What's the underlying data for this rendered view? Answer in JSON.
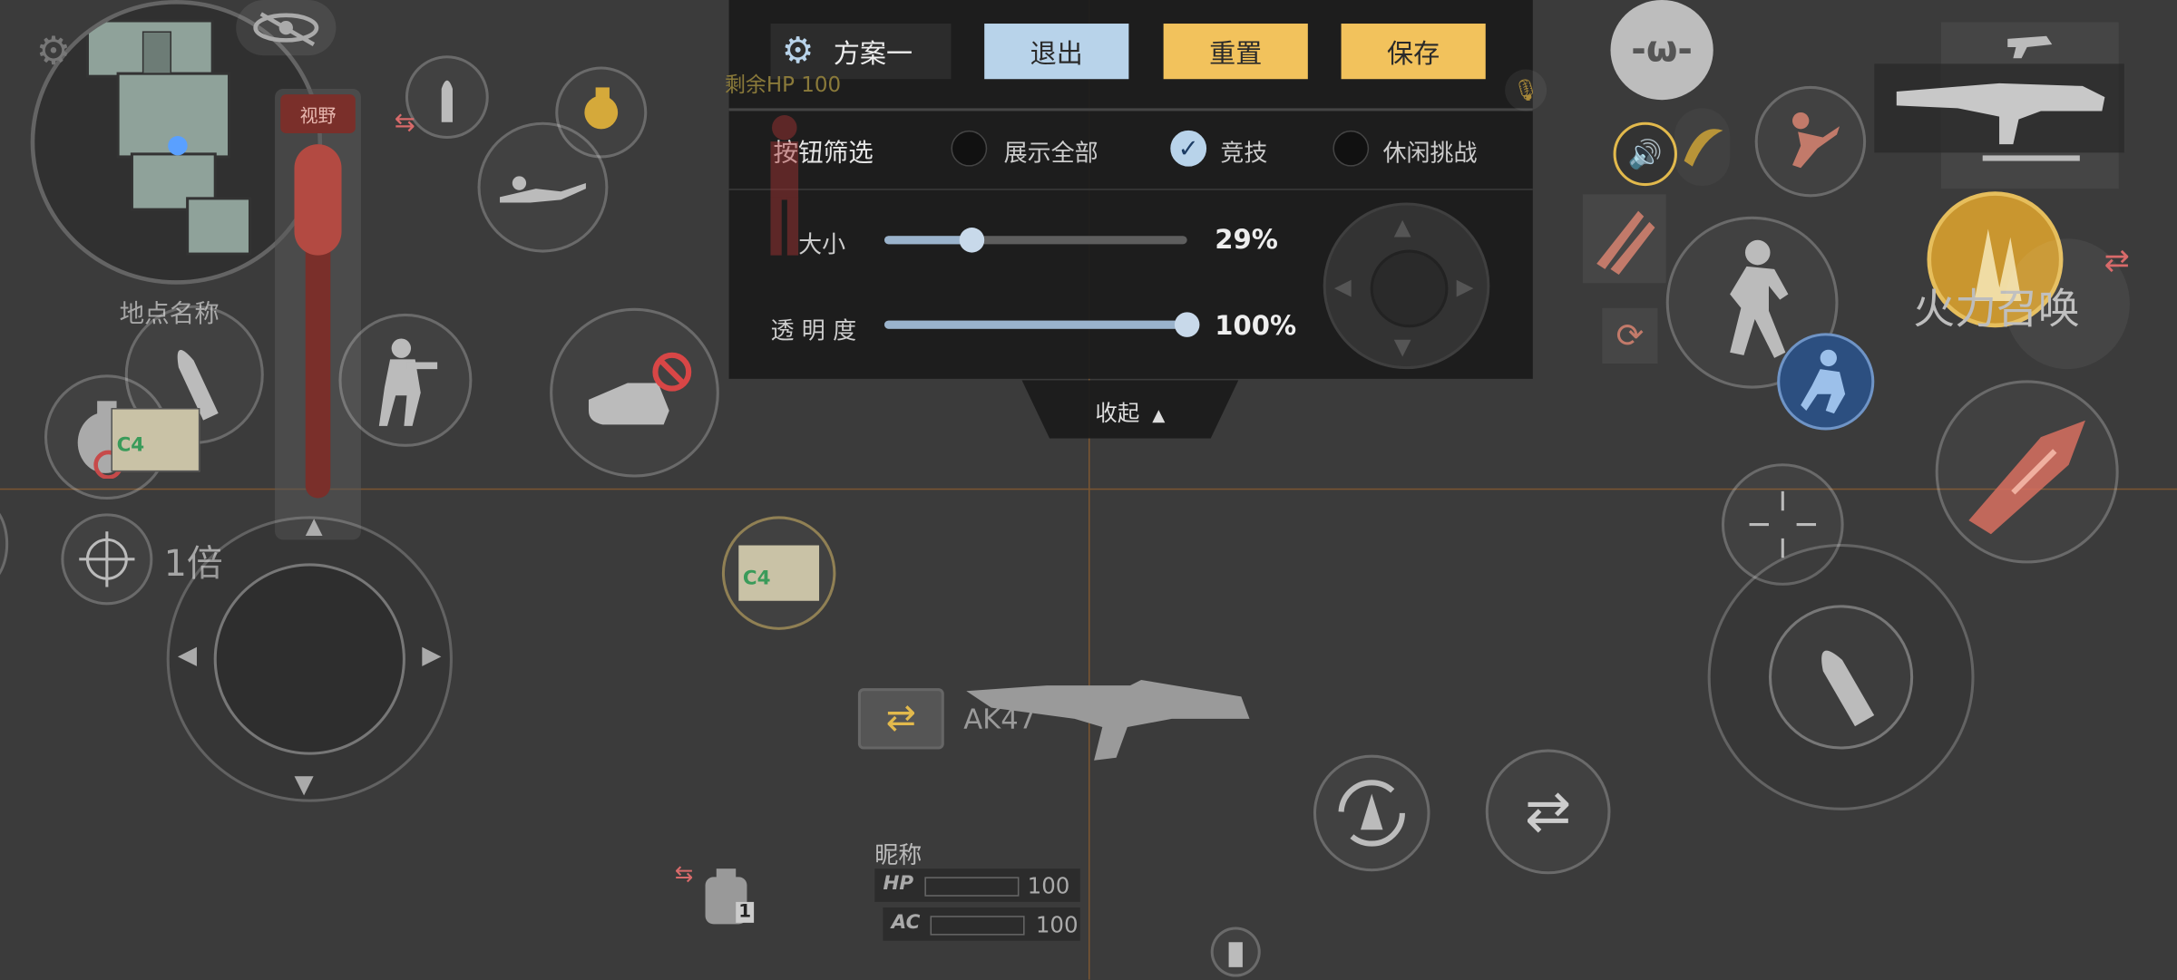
{
  "panel": {
    "scheme_name": "方案一",
    "exit_label": "退出",
    "reset_label": "重置",
    "save_label": "保存",
    "filter_label": "按钮筛选",
    "filter_options": [
      "展示全部",
      "竞技",
      "休闲挑战"
    ],
    "filter_selected": "竞技",
    "size_label": "大小",
    "size_value": 0.29,
    "size_text": "29%",
    "opacity_label": "透 明 度",
    "opacity_value": 1.0,
    "opacity_text": "100%",
    "collapse_label": "收起",
    "collapse_icon": "triangle-up-icon"
  },
  "hud": {
    "remaining_hp": "剩余HP 100",
    "location_name": "地点名称",
    "vision_label": "视野",
    "zoom_text": "1倍",
    "c4_label": "C4",
    "c4_label_center": "C4",
    "backpack_number": "1",
    "weapon_name": "AK47",
    "nickname_label": "昵称",
    "hp_label": "HP",
    "hp_value": "100",
    "ac_label": "AC",
    "ac_value": "100",
    "fire_support_label": "火力召唤"
  },
  "colors": {
    "accent_gold": "#f2c25c",
    "accent_blue": "#b8d3ea",
    "crosshair_line": "#7a5632",
    "red_gauge": "#c8443a"
  }
}
